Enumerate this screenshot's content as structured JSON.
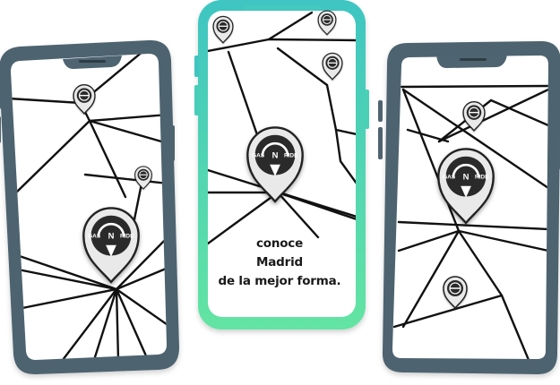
{
  "brand": {
    "logo_left": "GAS",
    "logo_mid": "N",
    "logo_right": "RIDE"
  },
  "tagline": {
    "line1": "conoce",
    "line2": "Madrid",
    "line3": "de la mejor forma."
  },
  "colors": {
    "side_phone_frame": "#4e6470",
    "center_phone_gradient_top": "#3fc5c2",
    "center_phone_gradient_bottom": "#63e4a3",
    "map_lines": "#111111",
    "pin_fill": "#e9e9e9"
  },
  "icons": {
    "map_pin": "map-pin-icon",
    "steering_wheel": "steering-wheel-icon"
  }
}
